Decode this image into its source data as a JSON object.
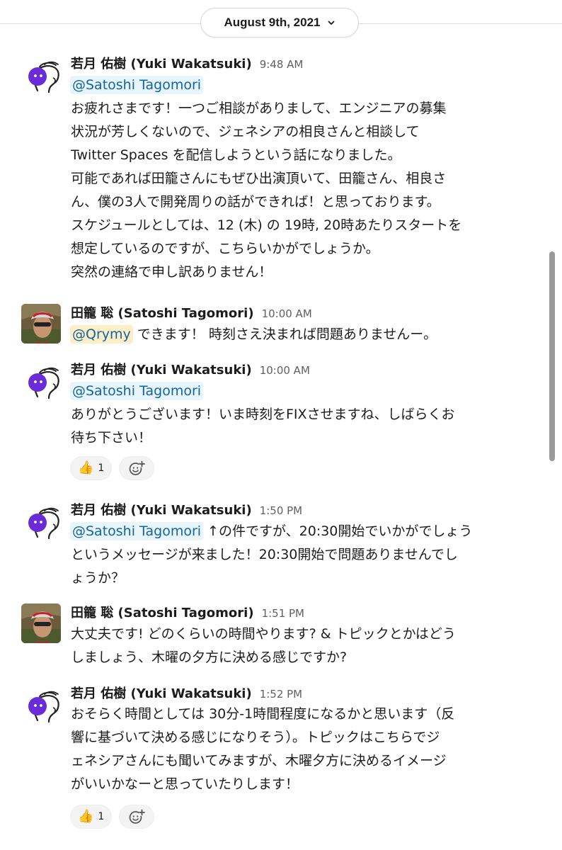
{
  "date_divider": {
    "label": "August 9th, 2021"
  },
  "messages": [
    {
      "sender": "若月 佑樹 (Yuki Wakatsuki)",
      "time": "9:48 AM",
      "mention": "@Satoshi Tagomori",
      "lines": [
        "お疲れさまです！一つご相談がありまして、エンジニアの募集",
        "状況が芳しくないので、ジェネシアの相良さんと相談して",
        "Twitter Spaces を配信しようという話になりました。",
        "可能であれば田籠さんにもぜひ出演頂いて、田籠さん、相良さ",
        "ん、僕の3人で開発周りの話ができれば！と思っております。",
        "スケジュールとしては、12 (木) の 19時, 20時あたりスタートを",
        "想定しているのですが、こちらいかがでしょうか。",
        "突然の連絡で申し訳ありません！"
      ]
    },
    {
      "sender": "田籠 聡 (Satoshi Tagomori)",
      "time": "10:00 AM",
      "mention": "@Qrymy",
      "first_line_rest": " できます！ 時刻さえ決まれば問題ありませんー。"
    },
    {
      "sender": "若月 佑樹 (Yuki Wakatsuki)",
      "time": "10:00 AM",
      "mention": "@Satoshi Tagomori",
      "lines": [
        "ありがとうございます！いま時刻をFIXさせますね、しばらくお",
        "待ち下さい！"
      ],
      "reactions": [
        {
          "emoji": "thumbs-up",
          "count": "1"
        }
      ]
    },
    {
      "sender": "若月 佑樹 (Yuki Wakatsuki)",
      "time": "1:50 PM",
      "mention": "@Satoshi Tagomori",
      "first_line_rest": " ↑の件ですが、20:30開始でいかがでしょう",
      "lines": [
        "というメッセージが来ました！20:30開始で問題ありませんでし",
        "ょうか？"
      ]
    },
    {
      "sender": "田籠 聡 (Satoshi Tagomori)",
      "time": "1:51 PM",
      "lines": [
        "大丈夫です! どのくらいの時間やります? & トピックとかはどう",
        "しましょう、木曜の夕方に決める感じですか?"
      ]
    },
    {
      "sender": "若月 佑樹 (Yuki Wakatsuki)",
      "time": "1:52 PM",
      "lines": [
        "おそらく時間としては 30分-1時間程度になるかと思います（反",
        "響に基づいて決める感じになりそう）。トピックはこちらでジ",
        "ェネシアさんにも聞いてみますが、木曜夕方に決めるイメージ",
        "がいいかなーと思っていたりします！"
      ],
      "reactions": [
        {
          "emoji": "thumbs-up",
          "count": "1"
        }
      ]
    }
  ],
  "colors": {
    "mention_bg": "#e8f5fa",
    "mention_text": "#1264a3",
    "self_mention_bg": "#fcefc7",
    "text": "#1d1c1d",
    "muted": "#616061"
  }
}
